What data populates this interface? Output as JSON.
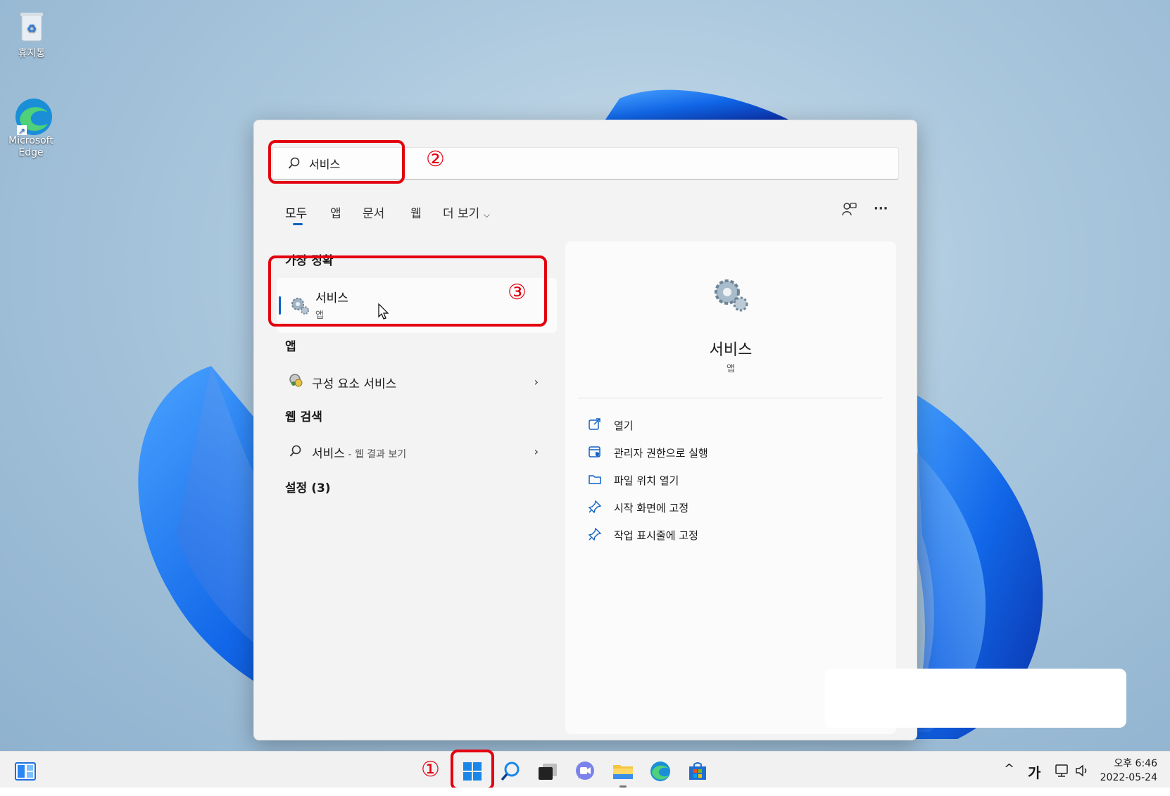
{
  "desktop": {
    "icons": [
      {
        "label": "휴지통",
        "icon": "recycle-bin-icon"
      },
      {
        "label": "Microsoft Edge",
        "icon": "edge-icon"
      }
    ]
  },
  "search": {
    "query": "서비스",
    "tabs": [
      "모두",
      "앱",
      "문서",
      "웹",
      "더 보기"
    ],
    "active_tab": "모두"
  },
  "results": {
    "best_match_header": "가장 정확",
    "best_match": {
      "title": "서비스",
      "subtitle": "앱",
      "icon": "services-gear-icon"
    },
    "apps_header": "앱",
    "apps": [
      {
        "label": "구성 요소 서비스",
        "icon": "component-services-icon"
      }
    ],
    "web_header": "웹 검색",
    "web": {
      "label": "서비스",
      "suffix": " - 웹 결과 보기"
    },
    "settings_header": "설정 (3)"
  },
  "preview": {
    "title": "서비스",
    "subtitle": "앱",
    "actions": [
      {
        "label": "열기",
        "icon": "open-external-icon"
      },
      {
        "label": "관리자 권한으로 실행",
        "icon": "run-as-admin-icon"
      },
      {
        "label": "파일 위치 열기",
        "icon": "folder-icon"
      },
      {
        "label": "시작 화면에 고정",
        "icon": "pin-icon"
      },
      {
        "label": "작업 표시줄에 고정",
        "icon": "pin-icon"
      }
    ]
  },
  "annotations": [
    "①",
    "②",
    "③"
  ],
  "taskbar": {
    "apps": [
      "widgets-icon",
      "start-icon",
      "search-icon",
      "task-view-icon",
      "chat-icon",
      "file-explorer-icon",
      "edge-icon",
      "store-icon"
    ],
    "tray": {
      "ime": "가",
      "chevron": "^"
    },
    "clock": {
      "time": "오후 6:46",
      "date": "2022-05-24"
    }
  },
  "colors": {
    "accent": "#0f62c5",
    "annotation_red": "#e3000f"
  }
}
